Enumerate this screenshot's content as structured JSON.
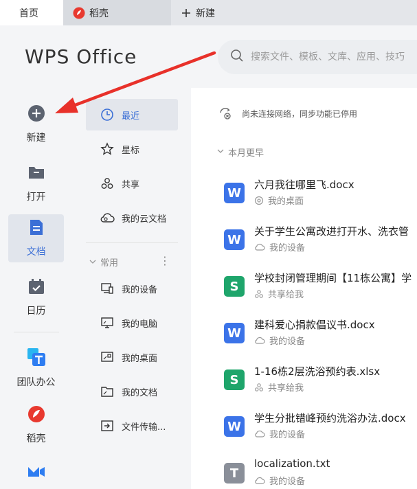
{
  "tabs": [
    {
      "label": "首页"
    },
    {
      "label": "稻壳"
    },
    {
      "label": "新建"
    }
  ],
  "brand": {
    "logo_text": "WPS Office"
  },
  "search": {
    "placeholder": "搜索文件、模板、文库、应用、技巧"
  },
  "rail": [
    {
      "label": "新建",
      "icon": "plus-circle-icon"
    },
    {
      "label": "打开",
      "icon": "folder-icon"
    },
    {
      "label": "文档",
      "icon": "document-icon",
      "active": true
    },
    {
      "label": "日历",
      "icon": "calendar-icon"
    },
    {
      "label": "团队办公",
      "icon": "team-icon"
    },
    {
      "label": "稻壳",
      "icon": "daoke-icon"
    },
    {
      "label": "",
      "icon": "meeting-icon"
    }
  ],
  "nav": [
    {
      "label": "最近",
      "icon": "clock-icon",
      "active": true
    },
    {
      "label": "星标",
      "icon": "star-icon"
    },
    {
      "label": "共享",
      "icon": "share-icon"
    },
    {
      "label": "我的云文档",
      "icon": "cloud-icon"
    }
  ],
  "nav_group": {
    "label": "常用",
    "more": "⋮"
  },
  "nav_common": [
    {
      "label": "我的设备",
      "icon": "device-icon"
    },
    {
      "label": "我的电脑",
      "icon": "computer-icon"
    },
    {
      "label": "我的桌面",
      "icon": "desktop-icon"
    },
    {
      "label": "我的文档",
      "icon": "folder-doc-icon"
    },
    {
      "label": "文件传输...",
      "icon": "transfer-icon"
    }
  ],
  "status": {
    "text": "尚未连接网络，同步功能已停用"
  },
  "section": {
    "label": "本月更早"
  },
  "files": [
    {
      "name": "六月我往哪里飞.docx",
      "location": "我的桌面",
      "type": "W",
      "color": "#3b73e8"
    },
    {
      "name": "关于学生公寓改进打开水、洗衣管",
      "location": "我的设备",
      "type": "W",
      "color": "#3b73e8"
    },
    {
      "name": "学校封闭管理期间【11栋公寓】学",
      "location": "共享给我",
      "type": "S",
      "color": "#1ea56b"
    },
    {
      "name": "建科爱心捐款倡议书.docx",
      "location": "我的设备",
      "type": "W",
      "color": "#3b73e8"
    },
    {
      "name": "1-16栋2层洗浴预约表.xlsx",
      "location": "共享给我",
      "type": "S",
      "color": "#1ea56b"
    },
    {
      "name": "学生分批错峰预约洗浴办法.docx",
      "location": "我的设备",
      "type": "W",
      "color": "#3b73e8"
    },
    {
      "name": "localization.txt",
      "location": "我的设备",
      "type": "T",
      "color": "#8a8f99"
    }
  ],
  "colors": {
    "accent": "#3b6fd6",
    "arrow": "#e8312a"
  }
}
